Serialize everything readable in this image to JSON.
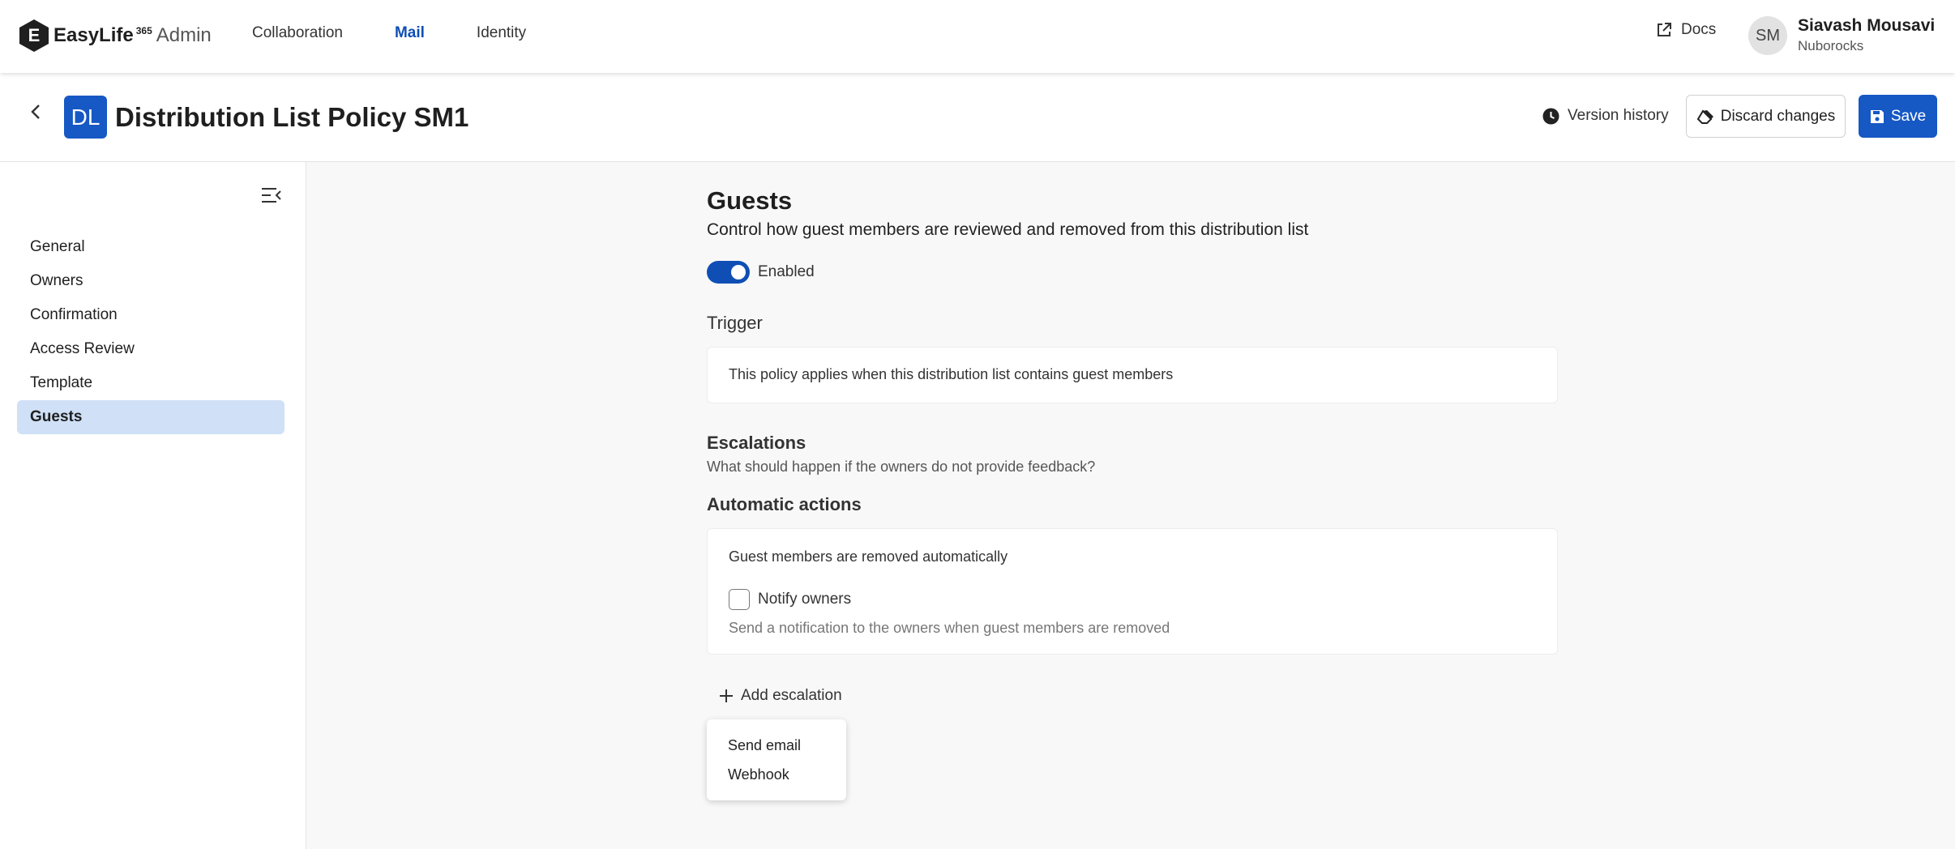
{
  "nav": {
    "brand_letter": "E",
    "brand_name": "EasyLife",
    "brand_sup": "365",
    "brand_suffix": "Admin",
    "items": [
      {
        "label": "Collaboration",
        "active": false
      },
      {
        "label": "Mail",
        "active": true
      },
      {
        "label": "Identity",
        "active": false
      }
    ],
    "docs_label": "Docs",
    "docs_icon": "external-link-icon",
    "user": {
      "initials": "SM",
      "name": "Siavash Mousavi",
      "org": "Nuborocks"
    }
  },
  "header": {
    "badge": "DL",
    "title": "Distribution List Policy SM1",
    "version_history_label": "Version history",
    "discard_label": "Discard changes",
    "save_label": "Save"
  },
  "sidebar": {
    "items": [
      {
        "label": "General"
      },
      {
        "label": "Owners"
      },
      {
        "label": "Confirmation"
      },
      {
        "label": "Access Review"
      },
      {
        "label": "Template"
      },
      {
        "label": "Guests",
        "active": true
      }
    ]
  },
  "main": {
    "title": "Guests",
    "description": "Control how guest members are reviewed and removed from this distribution list",
    "toggle_label": "Enabled",
    "toggle_on": true,
    "trigger_heading": "Trigger",
    "trigger_text": "This policy applies when this distribution list contains guest members",
    "escalations_heading": "Escalations",
    "escalations_desc": "What should happen if the owners do not provide feedback?",
    "auto_heading": "Automatic actions",
    "auto_text": "Guest members are removed automatically",
    "notify_label": "Notify owners",
    "notify_checked": false,
    "notify_desc": "Send a notification to the owners when guest members are removed",
    "add_escalation_label": "Add escalation",
    "menu_items": [
      "Send email",
      "Webhook"
    ]
  },
  "colors": {
    "accent": "#1658c4",
    "active_nav": "#0f4fb5",
    "sidebar_active_bg": "#cfe0f7"
  }
}
